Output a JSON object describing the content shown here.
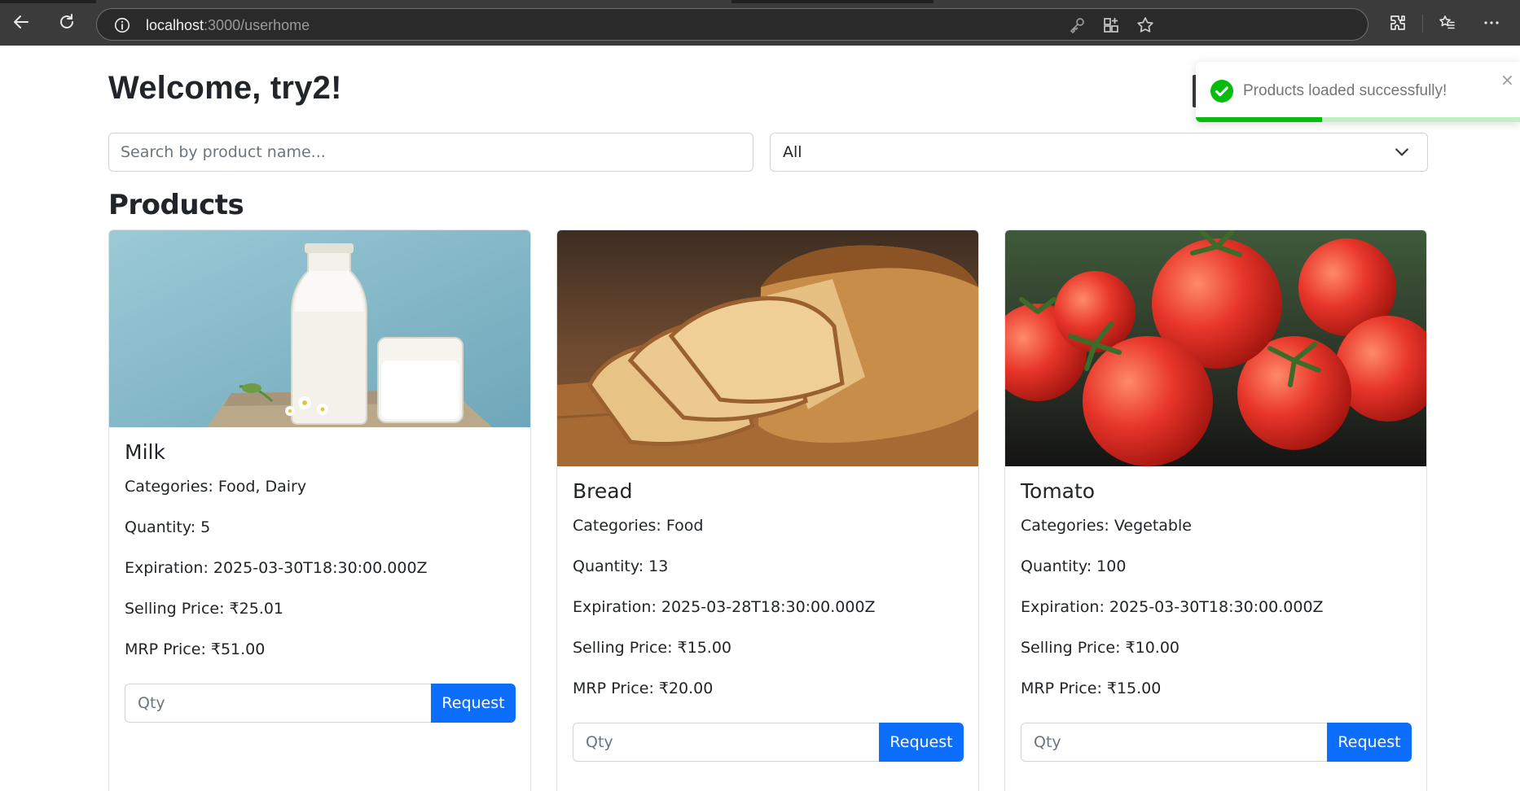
{
  "browser": {
    "url_host": "localhost",
    "url_path": ":3000/userhome"
  },
  "header": {
    "welcome": "Welcome, try2!"
  },
  "filters": {
    "search_placeholder": "Search by product name...",
    "category_value": "All"
  },
  "products_heading": "Products",
  "products": [
    {
      "name": "Milk",
      "categories": "Categories: Food, Dairy",
      "quantity": "Quantity: 5",
      "expiration": "Expiration: 2025-03-30T18:30:00.000Z",
      "selling_price": "Selling Price: ₹25.01",
      "mrp_price": "MRP Price: ₹51.00",
      "qty_placeholder": "Qty",
      "request_label": "Request"
    },
    {
      "name": "Bread",
      "categories": "Categories: Food",
      "quantity": "Quantity: 13",
      "expiration": "Expiration: 2025-03-28T18:30:00.000Z",
      "selling_price": "Selling Price: ₹15.00",
      "mrp_price": "MRP Price: ₹20.00",
      "qty_placeholder": "Qty",
      "request_label": "Request"
    },
    {
      "name": "Tomato",
      "categories": "Categories: Vegetable",
      "quantity": "Quantity: 100",
      "expiration": "Expiration: 2025-03-30T18:30:00.000Z",
      "selling_price": "Selling Price: ₹10.00",
      "mrp_price": "MRP Price: ₹15.00",
      "qty_placeholder": "Qty",
      "request_label": "Request"
    }
  ],
  "toast": {
    "message": "Products loaded successfully!",
    "close": "×",
    "progress": 0.39,
    "color": "#07bc0c"
  },
  "colors": {
    "primary": "#0d6efd",
    "chrome_bg": "#3b3b3b"
  }
}
